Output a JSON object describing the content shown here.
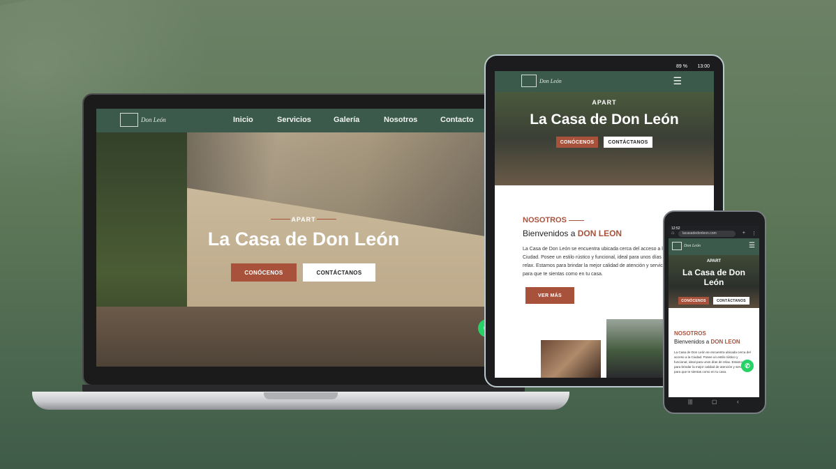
{
  "colors": {
    "brand_green": "#3b5a4b",
    "accent": "#a8523c",
    "whatsapp": "#25d366",
    "background": "#5d7758"
  },
  "logo": {
    "text": "Don León",
    "icon": "building-logo-icon"
  },
  "laptop": {
    "nav": [
      "Inicio",
      "Servicios",
      "Galería",
      "Nosotros",
      "Contacto"
    ],
    "hero": {
      "eyebrow": "APART",
      "title": "La Casa de Don León",
      "btn_primary": "CONÓCENOS",
      "btn_secondary": "CONTÁCTANOS"
    }
  },
  "tablet": {
    "status": {
      "battery": "89 %",
      "time": "13:00"
    },
    "hero": {
      "eyebrow": "APART",
      "title": "La Casa de Don León",
      "btn_primary": "CONÓCENOS",
      "btn_secondary": "CONTÁCTANOS"
    },
    "about": {
      "heading": "NOSOTROS",
      "subtitle_prefix": "Bienvenidos a ",
      "subtitle_highlight": "DON LEON",
      "text": "La Casa de Don León se encuentra ubicada cerca del acceso a la Ciudad. Posee un estilo rústico y funcional, ideal para unos días de relax. Estamos para brindar la mejor calidad de atención y servicio para que te sientas como en tu casa.",
      "button": "VER MÁS"
    }
  },
  "phone": {
    "status": {
      "time": "12:52"
    },
    "url": "lacasadedonleon.com",
    "hero": {
      "eyebrow": "APART",
      "title": "La Casa de Don León",
      "btn_primary": "CONÓCENOS",
      "btn_secondary": "CONTÁCTANOS"
    },
    "about": {
      "heading": "NOSOTROS",
      "subtitle_prefix": "Bienvenidos a ",
      "subtitle_highlight": "DON LEON",
      "text": "La Casa de Don León se encuentra ubicada cerca del acceso a la Ciudad. Posee un estilo rústico y funcional, ideal para unos días de relax. Estamos para brindar la mejor calidad de atención y servicio para que te sientas como en tu casa."
    }
  }
}
